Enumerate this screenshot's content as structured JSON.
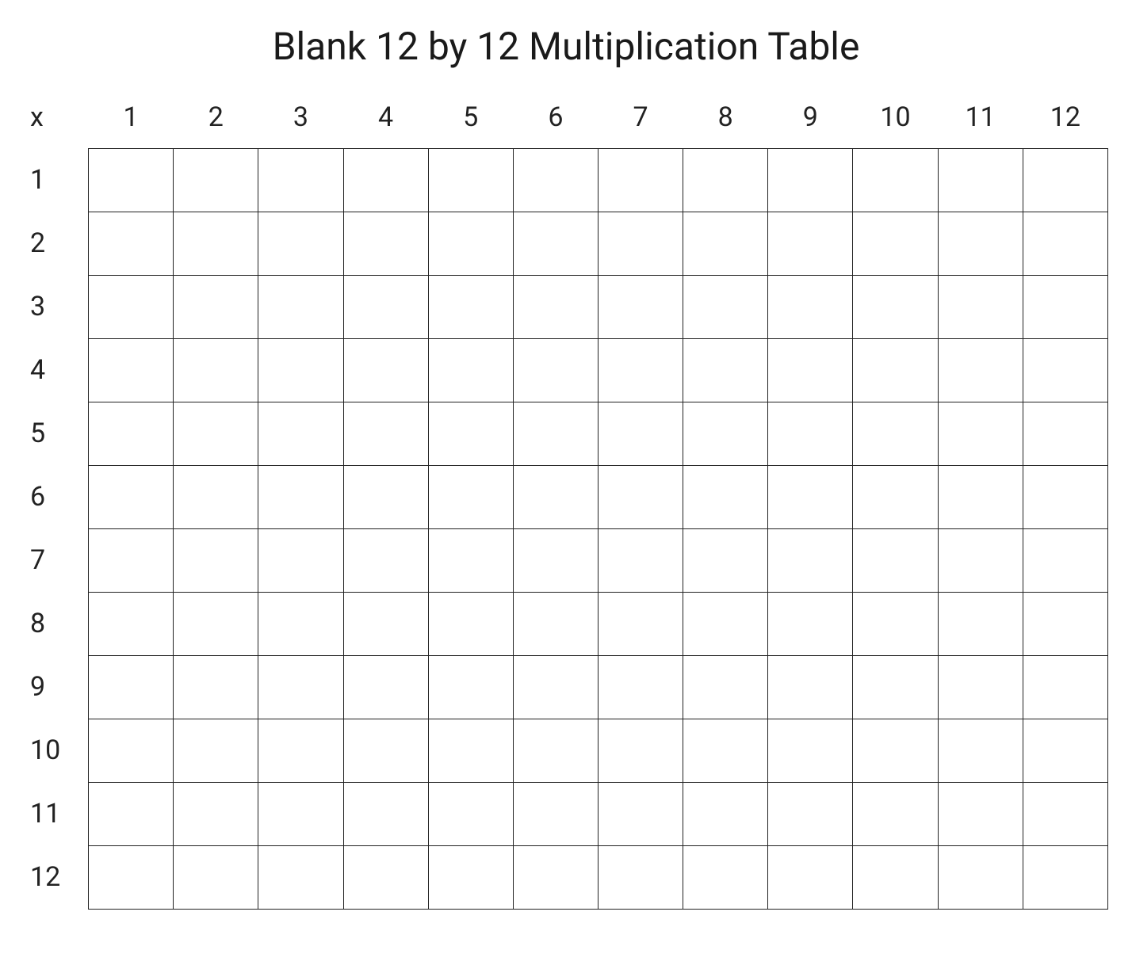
{
  "title": "Blank 12 by 12 Multiplication Table",
  "corner_label": "x",
  "column_headers": [
    "1",
    "2",
    "3",
    "4",
    "5",
    "6",
    "7",
    "8",
    "9",
    "10",
    "11",
    "12"
  ],
  "row_headers": [
    "1",
    "2",
    "3",
    "4",
    "5",
    "6",
    "7",
    "8",
    "9",
    "10",
    "11",
    "12"
  ],
  "cells": [
    [
      "",
      "",
      "",
      "",
      "",
      "",
      "",
      "",
      "",
      "",
      "",
      ""
    ],
    [
      "",
      "",
      "",
      "",
      "",
      "",
      "",
      "",
      "",
      "",
      "",
      ""
    ],
    [
      "",
      "",
      "",
      "",
      "",
      "",
      "",
      "",
      "",
      "",
      "",
      ""
    ],
    [
      "",
      "",
      "",
      "",
      "",
      "",
      "",
      "",
      "",
      "",
      "",
      ""
    ],
    [
      "",
      "",
      "",
      "",
      "",
      "",
      "",
      "",
      "",
      "",
      "",
      ""
    ],
    [
      "",
      "",
      "",
      "",
      "",
      "",
      "",
      "",
      "",
      "",
      "",
      ""
    ],
    [
      "",
      "",
      "",
      "",
      "",
      "",
      "",
      "",
      "",
      "",
      "",
      ""
    ],
    [
      "",
      "",
      "",
      "",
      "",
      "",
      "",
      "",
      "",
      "",
      "",
      ""
    ],
    [
      "",
      "",
      "",
      "",
      "",
      "",
      "",
      "",
      "",
      "",
      "",
      ""
    ],
    [
      "",
      "",
      "",
      "",
      "",
      "",
      "",
      "",
      "",
      "",
      "",
      ""
    ],
    [
      "",
      "",
      "",
      "",
      "",
      "",
      "",
      "",
      "",
      "",
      "",
      ""
    ],
    [
      "",
      "",
      "",
      "",
      "",
      "",
      "",
      "",
      "",
      "",
      "",
      ""
    ]
  ]
}
